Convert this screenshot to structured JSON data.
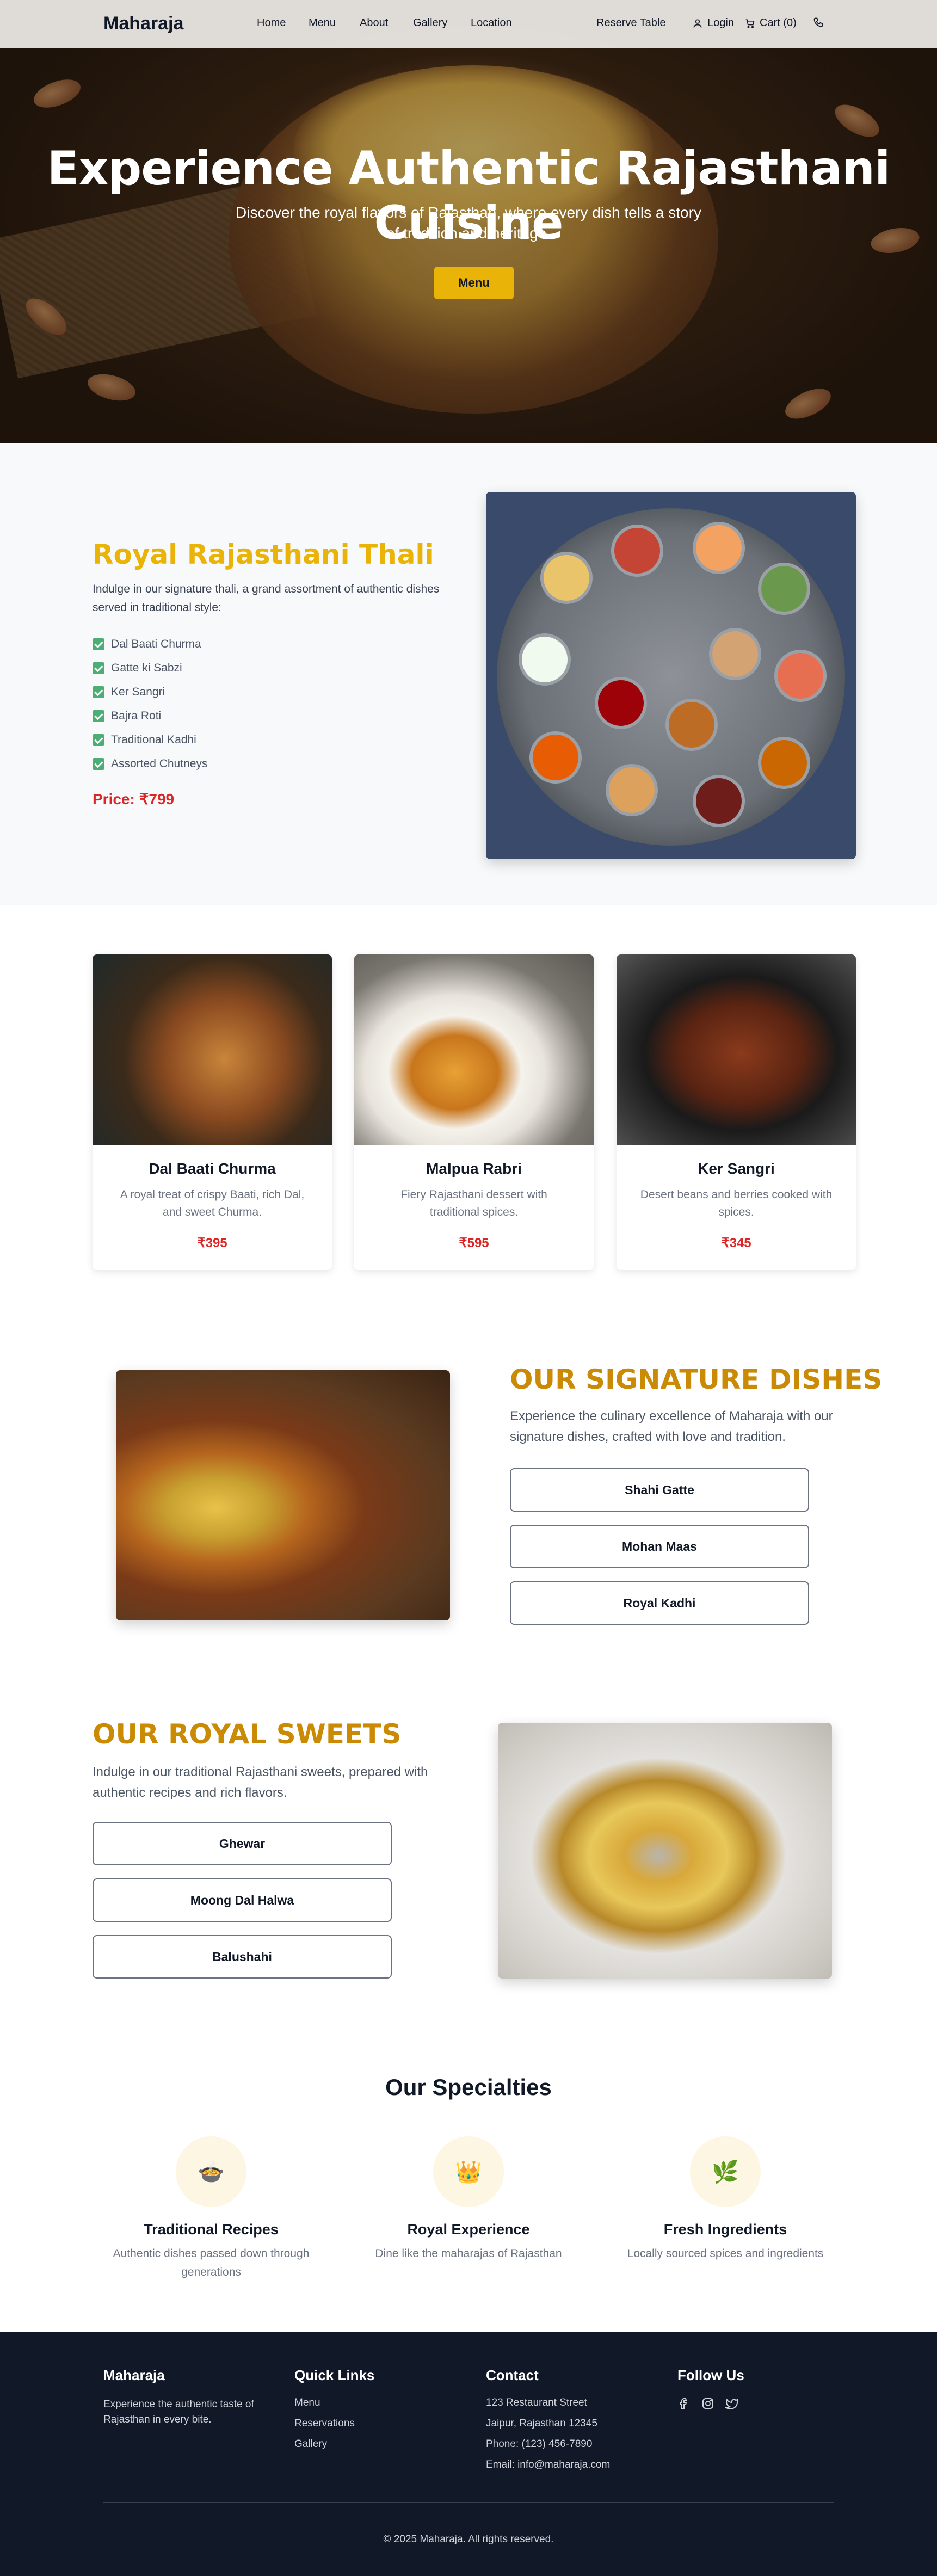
{
  "nav": {
    "brand": "Maharaja",
    "links": [
      "Home",
      "Menu",
      "About",
      "Gallery",
      "Location"
    ],
    "reserve": "Reserve Table",
    "login": "Login",
    "cart": "Cart (0)"
  },
  "hero": {
    "title": "Experience Authentic Rajasthani Cuisine",
    "subtitle": "Discover the royal flavors of Rajasthan, where every dish tells a story of tradition and heritage.",
    "button": "Menu"
  },
  "thali": {
    "title": "Royal Rajasthani Thali",
    "description": "Indulge in our signature thali, a grand assortment of authentic dishes served in traditional style:",
    "items": [
      "Dal Baati Churma",
      "Gatte ki Sabzi",
      "Ker Sangri",
      "Bajra Roti",
      "Traditional Kadhi",
      "Assorted Chutneys"
    ],
    "price": "Price: ₹799"
  },
  "dishes": [
    {
      "name": "Dal Baati Churma",
      "description": "A royal treat of crispy Baati, rich Dal, and sweet Churma.",
      "price": "₹395"
    },
    {
      "name": "Malpua Rabri",
      "description": "Fiery Rajasthani dessert with traditional spices.",
      "price": "₹595"
    },
    {
      "name": "Ker Sangri",
      "description": "Desert beans and berries cooked with spices.",
      "price": "₹345"
    }
  ],
  "signature": {
    "title": "OUR SIGNATURE DISHES",
    "description": "Experience the culinary excellence of Maharaja with our signature dishes, crafted with love and tradition.",
    "buttons": [
      "Shahi Gatte",
      "Mohan Maas",
      "Royal Kadhi"
    ]
  },
  "sweets": {
    "title": "OUR ROYAL SWEETS",
    "description": "Indulge in our traditional Rajasthani sweets, prepared with authentic recipes and rich flavors.",
    "buttons": [
      "Ghewar",
      "Moong Dal Halwa",
      "Balushahi"
    ]
  },
  "specialties": {
    "title": "Our Specialties",
    "items": [
      {
        "name": "Traditional Recipes",
        "description": "Authentic dishes passed down through generations",
        "icon": "pot-icon"
      },
      {
        "name": "Royal Experience",
        "description": "Dine like the maharajas of Rajasthan",
        "icon": "crown-icon"
      },
      {
        "name": "Fresh Ingredients",
        "description": "Locally sourced spices and ingredients",
        "icon": "leaf-icon"
      }
    ]
  },
  "footer": {
    "brand": "Maharaja",
    "tagline": "Experience the authentic taste of Rajasthan in every bite.",
    "quick_links_title": "Quick Links",
    "quick_links": [
      "Menu",
      "Reservations",
      "Gallery"
    ],
    "contact_title": "Contact",
    "contact": [
      "123 Restaurant Street",
      "Jaipur, Rajasthan 12345",
      "Phone: (123) 456-7890",
      "Email: info@maharaja.com"
    ],
    "follow_title": "Follow Us",
    "social": [
      "facebook-icon",
      "instagram-icon",
      "twitter-icon"
    ],
    "copyright": "© 2025 Maharaja. All rights reserved."
  },
  "colors": {
    "accent": "#eab308",
    "gold_heading": "#ca8a04",
    "price_red": "#dc2626",
    "footer_bg": "#111827",
    "check_green": "#4ead75"
  }
}
